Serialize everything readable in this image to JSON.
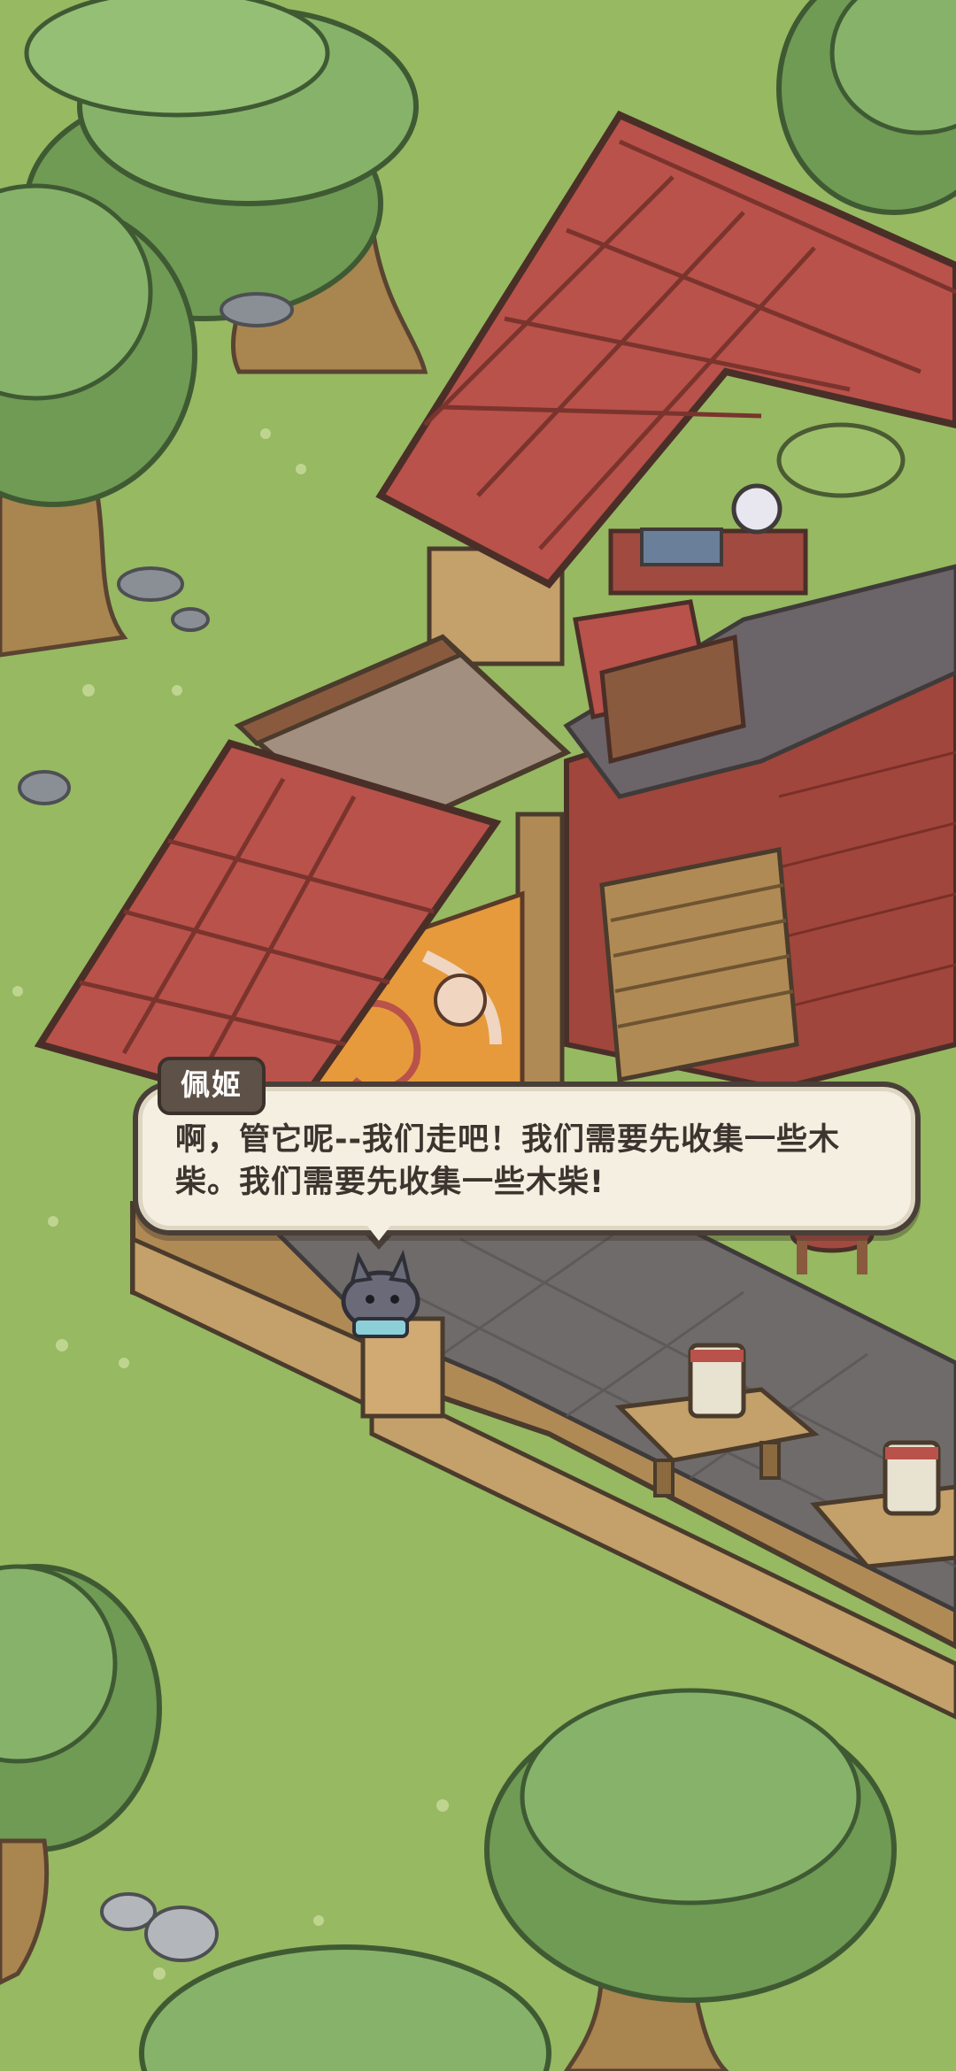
{
  "dialogue": {
    "speaker": "佩姬",
    "text": "啊，管它呢--我们走吧！我们需要先收集一些木柴。我们需要先收集一些木柴!"
  },
  "colors": {
    "grass": "#96b962",
    "roof": "#b9524a",
    "wood": "#b08a55",
    "stone_floor": "#6f6b6a",
    "tree_canopy": "#7fa860",
    "dialog_bg": "#f4efe1",
    "dialog_border": "#4a3f38"
  }
}
